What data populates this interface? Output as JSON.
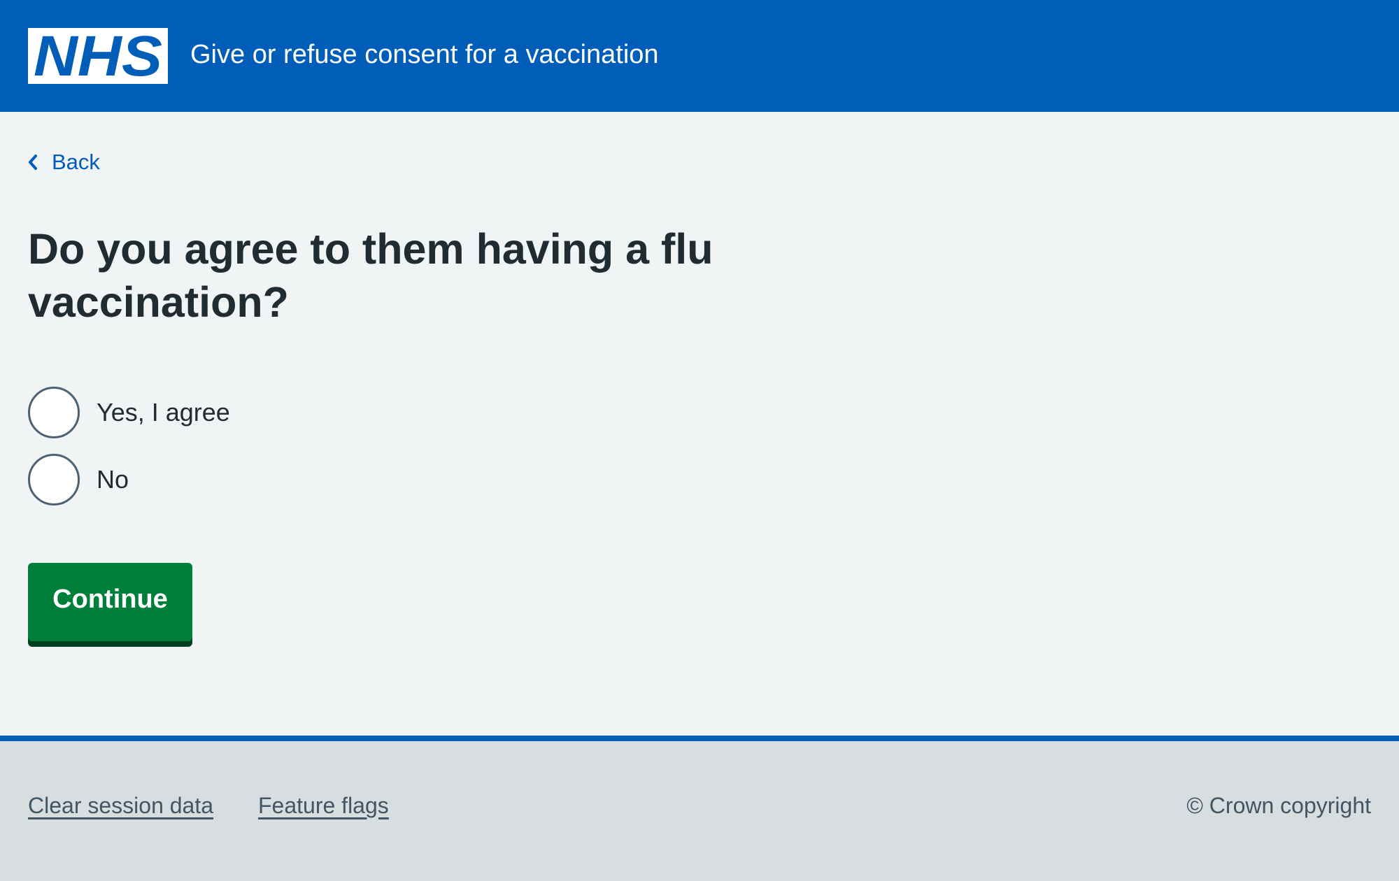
{
  "colors": {
    "brand": "#005eb8",
    "button_green": "#007f3b",
    "text": "#212b32",
    "background": "#f0f4f5",
    "footer_background": "#d8dde0"
  },
  "header": {
    "logo_text": "NHS",
    "service_name": "Give or refuse consent for a vaccination"
  },
  "nav": {
    "back_label": "Back",
    "back_icon": "chevron-left-icon"
  },
  "form": {
    "question": "Do you agree to them having a flu vaccination?",
    "options": [
      {
        "label": "Yes, I agree",
        "selected": false
      },
      {
        "label": "No",
        "selected": false
      }
    ],
    "continue_label": "Continue"
  },
  "footer": {
    "links": [
      {
        "label": "Clear session data"
      },
      {
        "label": "Feature flags"
      }
    ],
    "copyright": "© Crown copyright"
  }
}
